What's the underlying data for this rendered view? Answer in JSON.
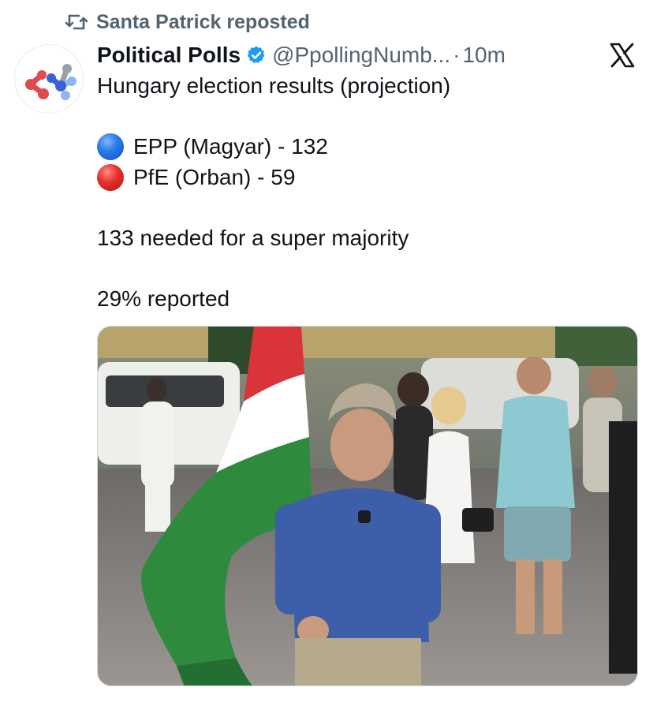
{
  "repost": {
    "icon": "repost-icon",
    "text": "Santa Patrick reposted"
  },
  "author": {
    "display_name": "Political Polls",
    "verified_icon": "verified-badge-icon",
    "handle": "@PpollingNumb...",
    "separator": "·",
    "time": "10m",
    "avatar_icon": "political-polls-logo"
  },
  "platform_icon": "x-logo-icon",
  "tweet": {
    "line1": "Hungary election results (projection)",
    "results": [
      {
        "icon": "blue-circle-emoji",
        "text": "EPP (Magyar) - 132",
        "color": "#2a7bea"
      },
      {
        "icon": "red-circle-emoji",
        "text": "PfE (Orban) - 59",
        "color": "#e7302a"
      }
    ],
    "supermajority": "133 needed for a super majority",
    "reported": "29% reported"
  },
  "media": {
    "kind": "photo",
    "subject": "man-with-hungarian-flag-in-crowd"
  },
  "colors": {
    "text_primary": "#0f1419",
    "text_secondary": "#536471",
    "verified_blue": "#1d9bf0",
    "flag_red": "#d9343a",
    "flag_white": "#ffffff",
    "flag_green": "#2e8b3e"
  }
}
